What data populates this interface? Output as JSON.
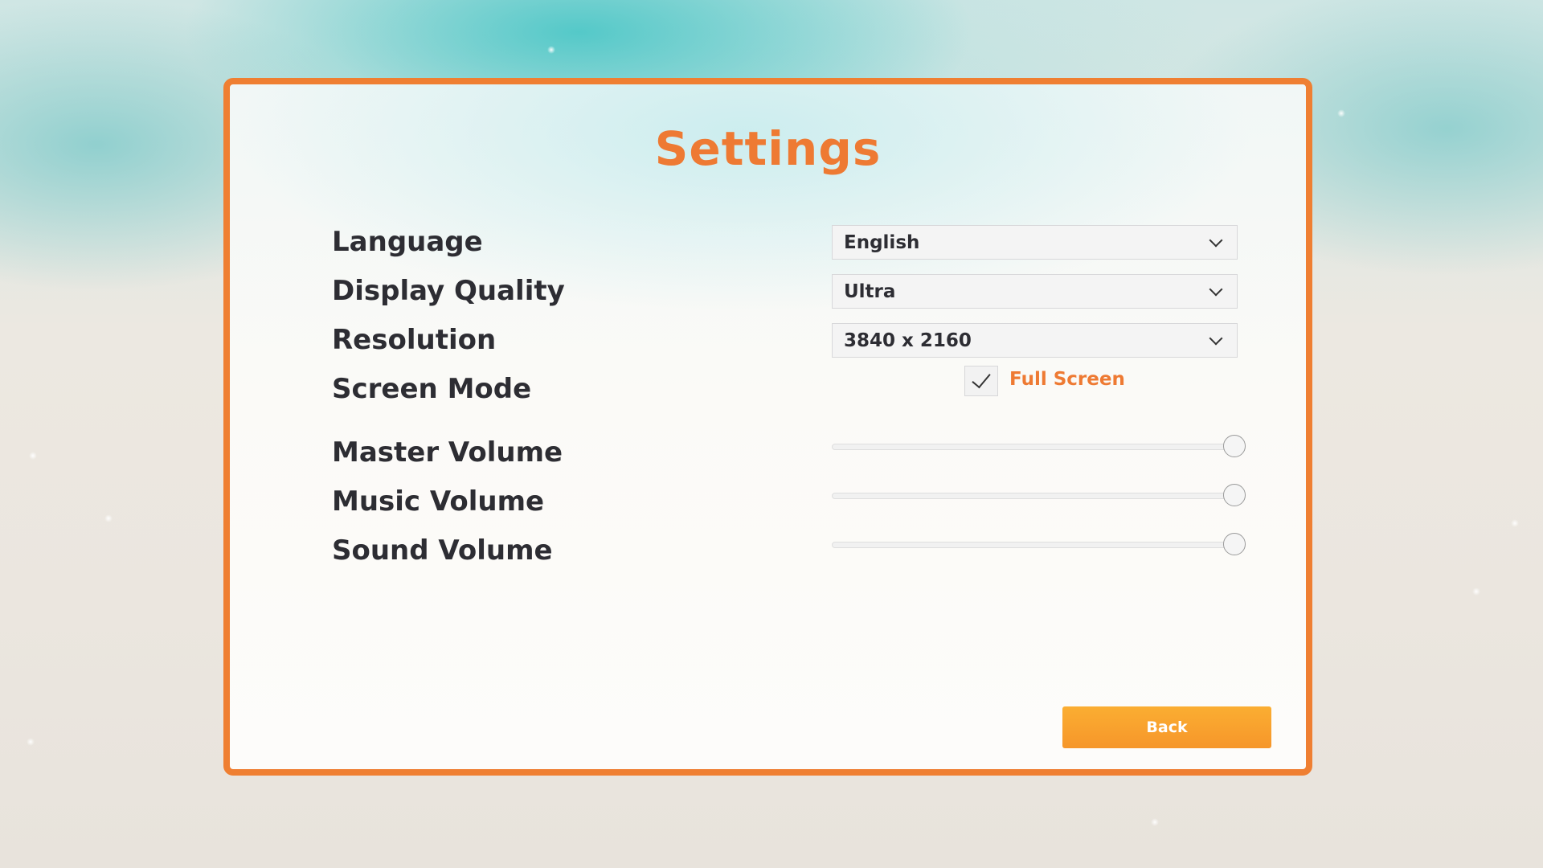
{
  "settings": {
    "title": "Settings",
    "rows": {
      "language": {
        "label": "Language",
        "value": "English"
      },
      "display_quality": {
        "label": "Display Quality",
        "value": "Ultra"
      },
      "resolution": {
        "label": "Resolution",
        "value": "3840 x 2160"
      },
      "screen_mode": {
        "label": "Screen Mode",
        "option_label": "Full Screen",
        "checked": true
      },
      "master_volume": {
        "label": "Master Volume",
        "level": 1.0
      },
      "music_volume": {
        "label": "Music Volume",
        "level": 1.0
      },
      "sound_volume": {
        "label": "Sound Volume",
        "level": 1.0
      }
    },
    "back_label": "Back"
  },
  "colors": {
    "accent": "#ee7a33",
    "panel_border": "#ef7f32",
    "button": "#f8a12e",
    "text": "#2d2d33"
  },
  "icons": {
    "dropdown": "chevron-down-icon",
    "checkbox": "checkmark-icon"
  }
}
